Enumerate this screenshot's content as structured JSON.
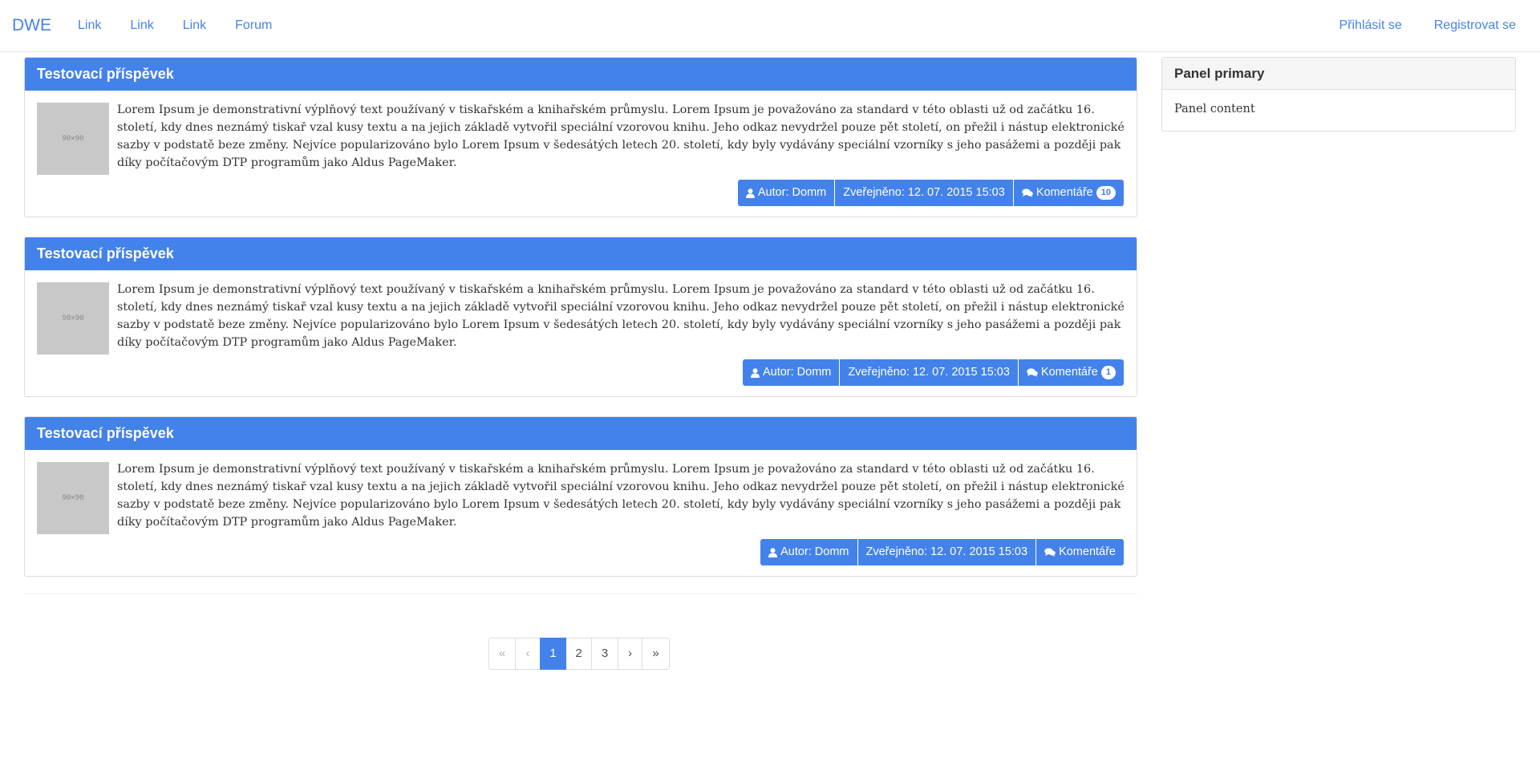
{
  "navbar": {
    "brand": "DWE",
    "links": [
      "Link",
      "Link",
      "Link",
      "Forum"
    ],
    "login": "Přihlásit se",
    "register": "Registrovat se"
  },
  "posts": [
    {
      "title": "Testovací příspěvek",
      "thumb_label": "90×90",
      "text": "Lorem Ipsum je demonstrativní výplňový text používaný v tiskařském a knihařském průmyslu. Lorem Ipsum je považováno za standard v této oblasti už od začátku 16. století, kdy dnes neznámý tiskař vzal kusy textu a na jejich základě vytvořil speciální vzorovou knihu. Jeho odkaz nevydržel pouze pět století, on přežil i nástup elektronické sazby v podstatě beze změny. Nejvíce popularizováno bylo Lorem Ipsum v šedesátých letech 20. století, kdy byly vydávány speciální vzorníky s jeho pasážemi a později pak díky počítačovým DTP programům jako Aldus PageMaker.",
      "author": "Autor: Domm",
      "published": "Zveřejněno: 12. 07. 2015 15:03",
      "comments_label": "Komentáře",
      "comments_count": "10"
    },
    {
      "title": "Testovací příspěvek",
      "thumb_label": "90×90",
      "text": "Lorem Ipsum je demonstrativní výplňový text používaný v tiskařském a knihařském průmyslu. Lorem Ipsum je považováno za standard v této oblasti už od začátku 16. století, kdy dnes neznámý tiskař vzal kusy textu a na jejich základě vytvořil speciální vzorovou knihu. Jeho odkaz nevydržel pouze pět století, on přežil i nástup elektronické sazby v podstatě beze změny. Nejvíce popularizováno bylo Lorem Ipsum v šedesátých letech 20. století, kdy byly vydávány speciální vzorníky s jeho pasážemi a později pak díky počítačovým DTP programům jako Aldus PageMaker.",
      "author": "Autor: Domm",
      "published": "Zveřejněno: 12. 07. 2015 15:03",
      "comments_label": "Komentáře",
      "comments_count": "1"
    },
    {
      "title": "Testovací příspěvek",
      "thumb_label": "90×90",
      "text": "Lorem Ipsum je demonstrativní výplňový text používaný v tiskařském a knihařském průmyslu. Lorem Ipsum je považováno za standard v této oblasti už od začátku 16. století, kdy dnes neznámý tiskař vzal kusy textu a na jejich základě vytvořil speciální vzorovou knihu. Jeho odkaz nevydržel pouze pět století, on přežil i nástup elektronické sazby v podstatě beze změny. Nejvíce popularizováno bylo Lorem Ipsum v šedesátých letech 20. století, kdy byly vydávány speciální vzorníky s jeho pasážemi a později pak díky počítačovým DTP programům jako Aldus PageMaker.",
      "author": "Autor: Domm",
      "published": "Zveřejněno: 12. 07. 2015 15:03",
      "comments_label": "Komentáře",
      "comments_count": ""
    }
  ],
  "pagination": {
    "first": "«",
    "prev": "‹",
    "pages": [
      "1",
      "2",
      "3"
    ],
    "current": "1",
    "next": "›",
    "last": "»"
  },
  "sidebar": {
    "panel_title": "Panel primary",
    "panel_content": "Panel content"
  },
  "icons": {
    "author": "user-icon",
    "comments": "comments-icon"
  },
  "colors": {
    "accent": "#4382ea",
    "link": "#4682e8",
    "panel_heading_bg": "#f5f5f5",
    "border": "#dddddd"
  }
}
